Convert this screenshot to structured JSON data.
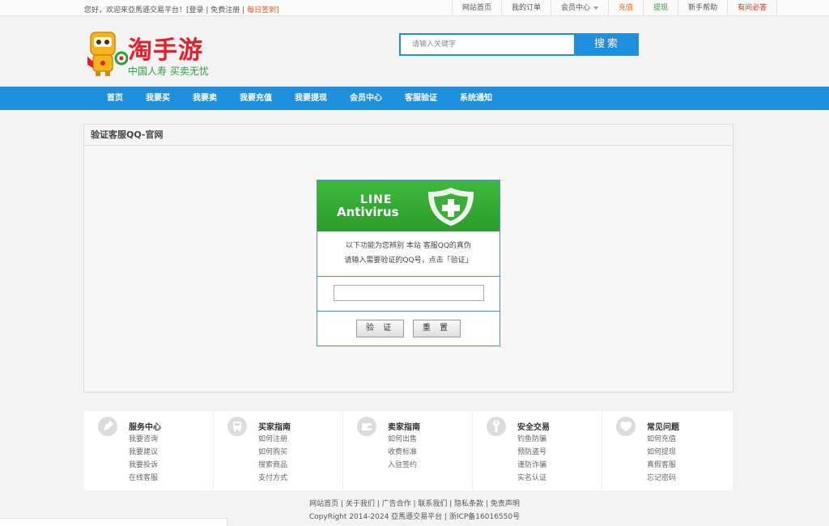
{
  "topbar": {
    "greeting": "您好，欢迎来亞馬遜交易平台！",
    "login": "[登录",
    "register": "免费注册",
    "signin": "每日签到]",
    "nav": [
      {
        "label": "网站首页"
      },
      {
        "label": "我的订单"
      },
      {
        "label": "会员中心"
      },
      {
        "label": "充值"
      },
      {
        "label": "提现"
      },
      {
        "label": "新手帮助"
      },
      {
        "label": "有问必答"
      }
    ]
  },
  "header": {
    "brand": "淘手游",
    "slogan": "中国人寿  买卖无忧",
    "search_placeholder": "请输入关键字",
    "search_button": "搜索"
  },
  "mainnav": {
    "items": [
      "首页",
      "我要买",
      "我要卖",
      "我要充值",
      "我要提现",
      "会员中心",
      "客服验证",
      "系统通知"
    ]
  },
  "panel": {
    "title": "验证客服QQ-官网",
    "banner_line1": "LINE",
    "banner_line2": "Antivirus",
    "text_line1": "以下功能为您辨别 本站 客服QQ的真伪",
    "text_line2": "请输入需要验证的QQ号，点击「验证」",
    "input_value": "",
    "verify_button": "验 证",
    "reset_button": "重 置"
  },
  "guides": [
    {
      "title": "服务中心",
      "icon": "pen-icon",
      "links": [
        "我要咨询",
        "我要建议",
        "我要投诉",
        "在线客服"
      ]
    },
    {
      "title": "买家指南",
      "icon": "bus-icon",
      "links": [
        "如何注册",
        "如何购买",
        "搜索商品",
        "支付方式"
      ]
    },
    {
      "title": "卖家指南",
      "icon": "wallet-icon",
      "links": [
        "如何出售",
        "收费标准",
        "入驻签约"
      ]
    },
    {
      "title": "安全交易",
      "icon": "wrench-icon",
      "links": [
        "钓鱼防骗",
        "预防盗号",
        "谨防诈骗",
        "实名认证"
      ]
    },
    {
      "title": "常见问题",
      "icon": "heart-icon",
      "links": [
        "如何充值",
        "如何提现",
        "真假客服",
        "忘记密码"
      ]
    }
  ],
  "footer": {
    "links": "网站首页 | 关于我们 | 广告合作 | 联系我们 | 隐私条款 | 免责声明",
    "copyright": "CopyRight 2014-2024 亞馬遜交易平台 | 浙ICP备16016550号"
  },
  "colors": {
    "primary_blue": "#1e90e0",
    "brand_red": "#e4202a",
    "slogan_green": "#2c9e3a",
    "banner_green": "#3fb93d"
  }
}
